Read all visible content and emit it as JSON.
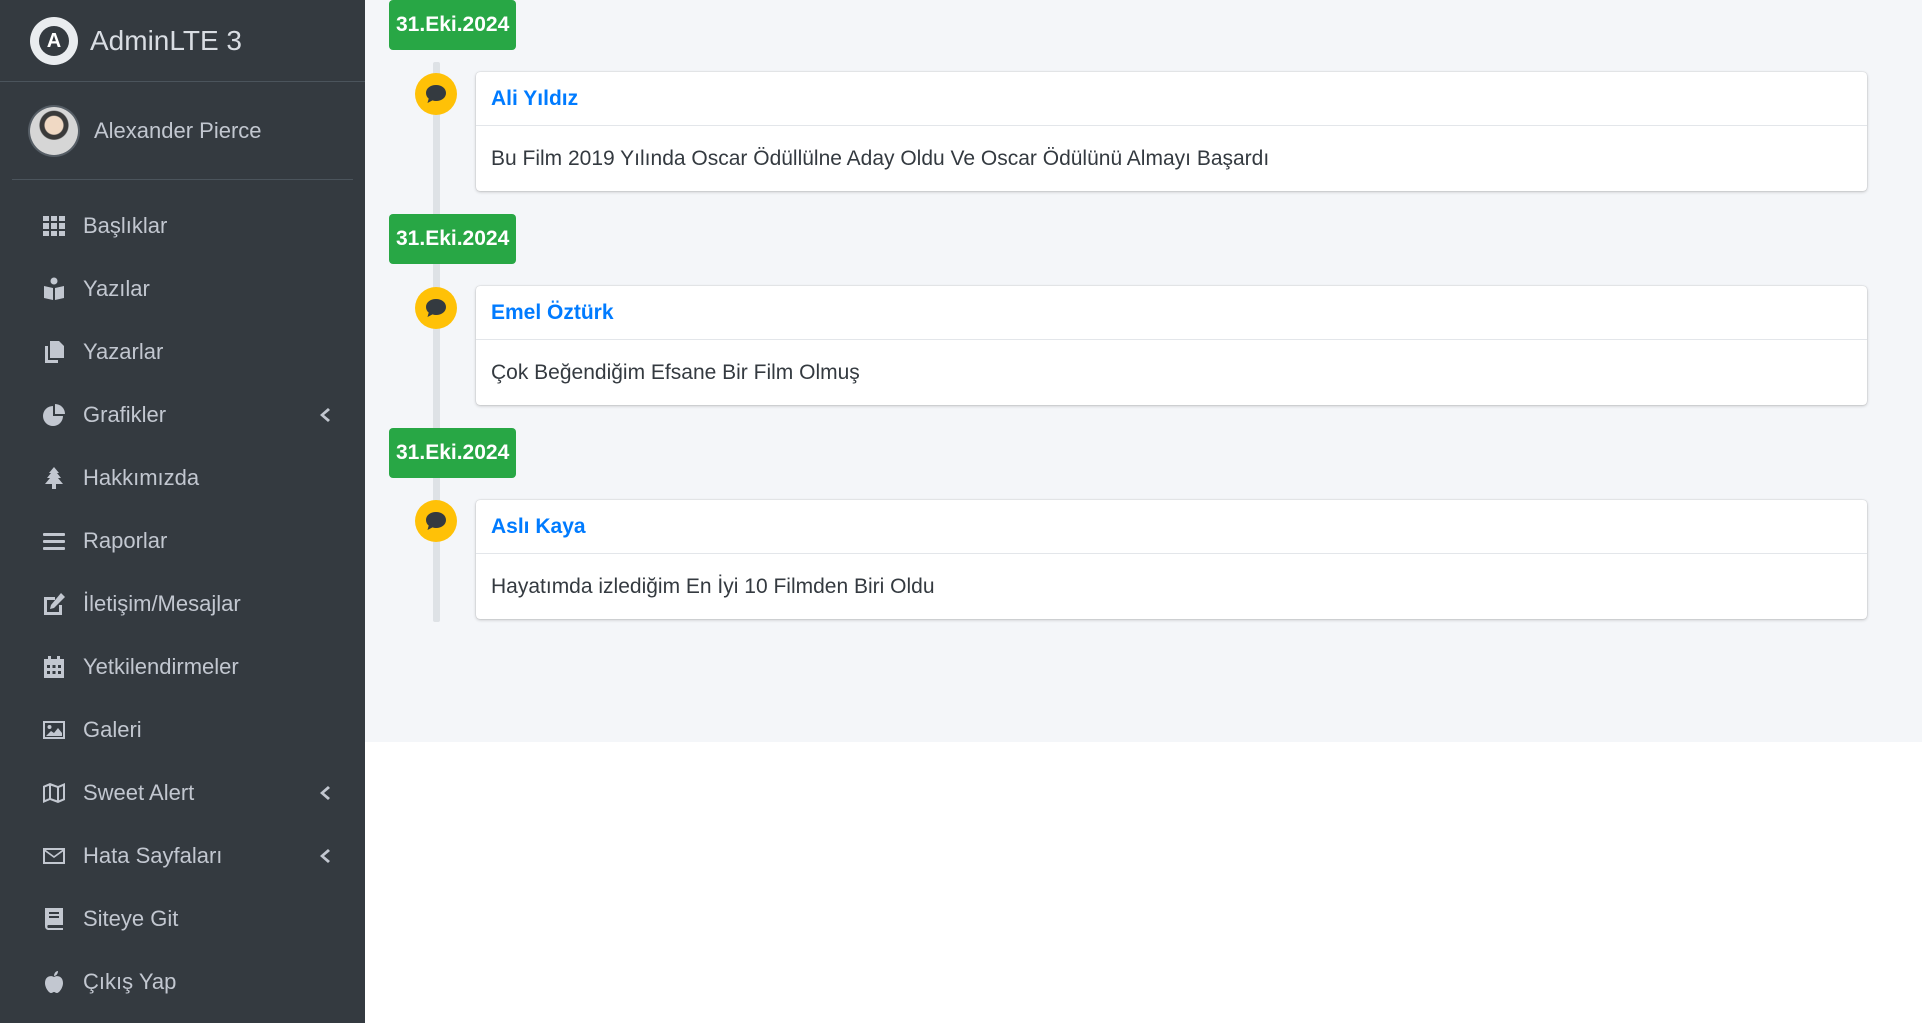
{
  "brand": {
    "name": "AdminLTE 3",
    "logo_letter": "A"
  },
  "user": {
    "name": "Alexander Pierce"
  },
  "nav": [
    {
      "label": "Başlıklar",
      "icon": "grid-icon",
      "has_children": false
    },
    {
      "label": "Yazılar",
      "icon": "book-reader-icon",
      "has_children": false
    },
    {
      "label": "Yazarlar",
      "icon": "copy-icon",
      "has_children": false
    },
    {
      "label": "Grafikler",
      "icon": "chart-pie-icon",
      "has_children": true
    },
    {
      "label": "Hakkımızda",
      "icon": "tree-icon",
      "has_children": false
    },
    {
      "label": "Raporlar",
      "icon": "bars-icon",
      "has_children": false
    },
    {
      "label": "İletişim/Mesajlar",
      "icon": "edit-icon",
      "has_children": false
    },
    {
      "label": "Yetkilendirmeler",
      "icon": "calendar-icon",
      "has_children": false
    },
    {
      "label": "Galeri",
      "icon": "image-icon",
      "has_children": false
    },
    {
      "label": "Sweet Alert",
      "icon": "map-icon",
      "has_children": true
    },
    {
      "label": "Hata Sayfaları",
      "icon": "envelope-icon",
      "has_children": true
    },
    {
      "label": "Siteye Git",
      "icon": "book-icon",
      "has_children": false
    },
    {
      "label": "Çıkış Yap",
      "icon": "apple-icon",
      "has_children": false
    }
  ],
  "timeline": [
    {
      "date": "31.Eki.2024",
      "author": "Ali Yıldız",
      "text": "Bu Film 2019 Yılında Oscar Ödüllülne Aday Oldu Ve Oscar Ödülünü Almayı Başardı"
    },
    {
      "date": "31.Eki.2024",
      "author": "Emel Öztürk",
      "text": "Çok Beğendiğim Efsane Bir Film Olmuş"
    },
    {
      "date": "31.Eki.2024",
      "author": "Aslı Kaya",
      "text": "Hayatımda izlediğim En İyi 10 Filmden Biri Oldu"
    }
  ],
  "colors": {
    "sidebar_bg": "#343a40",
    "date_badge": "#28a745",
    "comment_icon": "#ffc107",
    "author_link": "#007bff"
  }
}
